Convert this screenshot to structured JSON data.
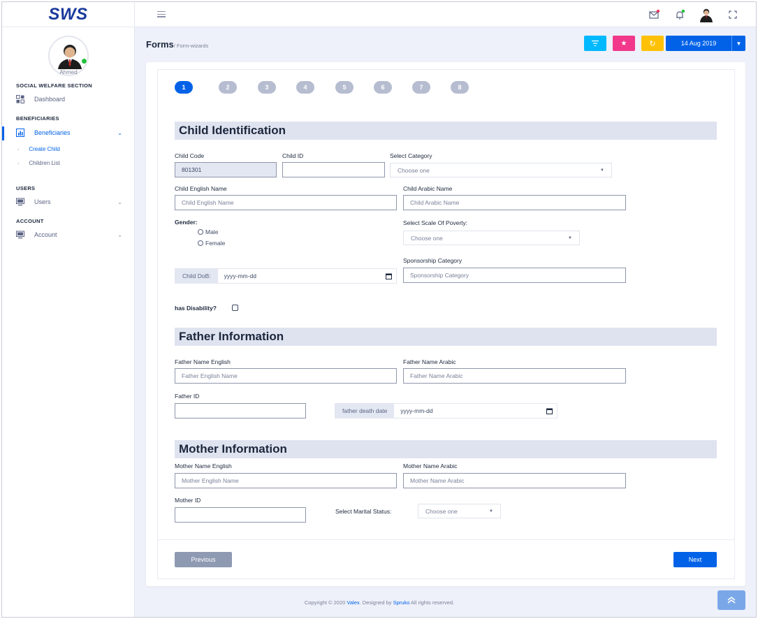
{
  "app": {
    "logo": "SWS"
  },
  "user": {
    "name": "Ahmed"
  },
  "sidebar": {
    "sections": [
      {
        "title": "SOCIAL WELFARE SECTION"
      },
      {
        "title": "BENEFICIARIES"
      },
      {
        "title": "USERS"
      },
      {
        "title": "ACCOUNT"
      }
    ],
    "items": [
      {
        "label": "Dashboard",
        "icon": "grid-icon"
      },
      {
        "label": "Beneficiaries",
        "icon": "chart-icon",
        "active": true
      },
      {
        "label": "Users",
        "icon": "monitor-icon"
      },
      {
        "label": "Account",
        "icon": "monitor-icon"
      }
    ],
    "subitems": [
      {
        "label": "Create Child",
        "active": true
      },
      {
        "label": "Children List"
      }
    ]
  },
  "topbar": {
    "icons": [
      "hamburger-icon",
      "mail-icon",
      "bell-icon",
      "avatar",
      "fullscreen-icon"
    ]
  },
  "breadcrumb": {
    "title": "Forms",
    "sub": "/ Form-wizards"
  },
  "toolbar": {
    "buttons": [
      {
        "icon": "filter-icon",
        "color": "#00b9ff"
      },
      {
        "icon": "star-icon",
        "color": "#f1388b"
      },
      {
        "icon": "refresh-icon",
        "color": "#ffc107"
      }
    ],
    "date": "14 Aug 2019"
  },
  "wizard": {
    "steps": [
      "1",
      "2",
      "3",
      "4",
      "5",
      "6",
      "7",
      "8"
    ],
    "active_step": "1"
  },
  "child": {
    "section_title": "Child Identification",
    "code_label": "Child Code",
    "code_value": "801301",
    "id_label": "Child ID",
    "category_label": "Select Category",
    "category_value": "Choose one",
    "english_name_label": "Child English Name",
    "english_name_placeholder": "Child English Name",
    "arabic_name_label": "Child Arabic Name",
    "arabic_name_placeholder": "Child Arabic Name",
    "gender_label": "Gender:",
    "gender_male": "Male",
    "gender_female": "Female",
    "poverty_label": "Select Scale Of Poverty:",
    "poverty_value": "Choose one",
    "sponsorship_label": "Sponsorship Category",
    "sponsorship_placeholder": "Sponsorship Category",
    "dob_label": "Child DoB:",
    "dob_value": "yyyy-mm-dd",
    "disability_label": "has Disability?"
  },
  "father": {
    "section_title": "Father Information",
    "english_label": "Father Name English",
    "english_placeholder": "Father English Name",
    "arabic_label": "Father Name Arabic",
    "arabic_placeholder": "Father Name Arabic",
    "id_label": "Father ID",
    "death_label": "father death date",
    "death_value": "yyyy-mm-dd"
  },
  "mother": {
    "section_title": "Mother Information",
    "english_label": "Mother Name English",
    "english_placeholder": "Mother English Name",
    "arabic_label": "Mother Name Arabic",
    "arabic_placeholder": "Mother Name Arabic",
    "id_label": "Mother ID",
    "marital_label": "Select Marital Status:",
    "marital_value": "Choose one"
  },
  "nav": {
    "previous": "Previous",
    "next": "Next"
  },
  "footer": {
    "prefix": "Copyright © 2020",
    "brand": "Valex",
    "mid": ". Designed by",
    "author": "Spruko",
    "suffix": "All rights reserved."
  }
}
